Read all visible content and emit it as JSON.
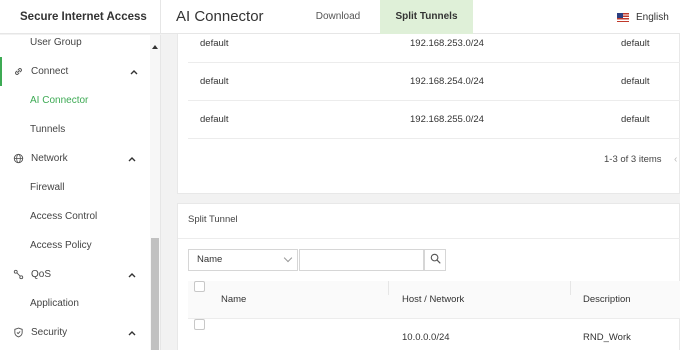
{
  "header": {
    "brand": "Secure Internet Access",
    "page_title": "AI Connector",
    "tabs": [
      {
        "label": "Download",
        "active": false
      },
      {
        "label": "Split Tunnels",
        "active": true
      }
    ],
    "language": {
      "label": "English",
      "flag_icon": "us-flag-icon"
    }
  },
  "colors": {
    "accent": "#3daa54",
    "active_tab_bg": "#dff0d8"
  },
  "sidebar": {
    "items": [
      {
        "label": "User Group",
        "type": "sub"
      },
      {
        "label": "Connect",
        "type": "section",
        "icon": "link-icon",
        "expanded": true
      },
      {
        "label": "AI Connector",
        "type": "sub",
        "selected": true
      },
      {
        "label": "Tunnels",
        "type": "sub"
      },
      {
        "label": "Network",
        "type": "section",
        "icon": "globe-icon",
        "expanded": true
      },
      {
        "label": "Firewall",
        "type": "sub"
      },
      {
        "label": "Access Control",
        "type": "sub"
      },
      {
        "label": "Access Policy",
        "type": "sub"
      },
      {
        "label": "QoS",
        "type": "section",
        "icon": "qos-icon",
        "expanded": true
      },
      {
        "label": "Application",
        "type": "sub"
      },
      {
        "label": "Security",
        "type": "section",
        "icon": "shield-icon",
        "expanded": true
      }
    ]
  },
  "routes_table": {
    "rows": [
      {
        "name": "default",
        "network": "192.168.253.0/24",
        "type": "default"
      },
      {
        "name": "default",
        "network": "192.168.254.0/24",
        "type": "default"
      },
      {
        "name": "default",
        "network": "192.168.255.0/24",
        "type": "default"
      }
    ],
    "pagination": "1-3 of 3 items"
  },
  "split_tunnel": {
    "title": "Split Tunnel",
    "filter_field": "Name",
    "search_value": "",
    "columns": [
      "Name",
      "Host / Network",
      "Description"
    ],
    "rows": [
      {
        "name": "",
        "host": "10.0.0.0/24",
        "description": "RND_Work"
      }
    ]
  }
}
